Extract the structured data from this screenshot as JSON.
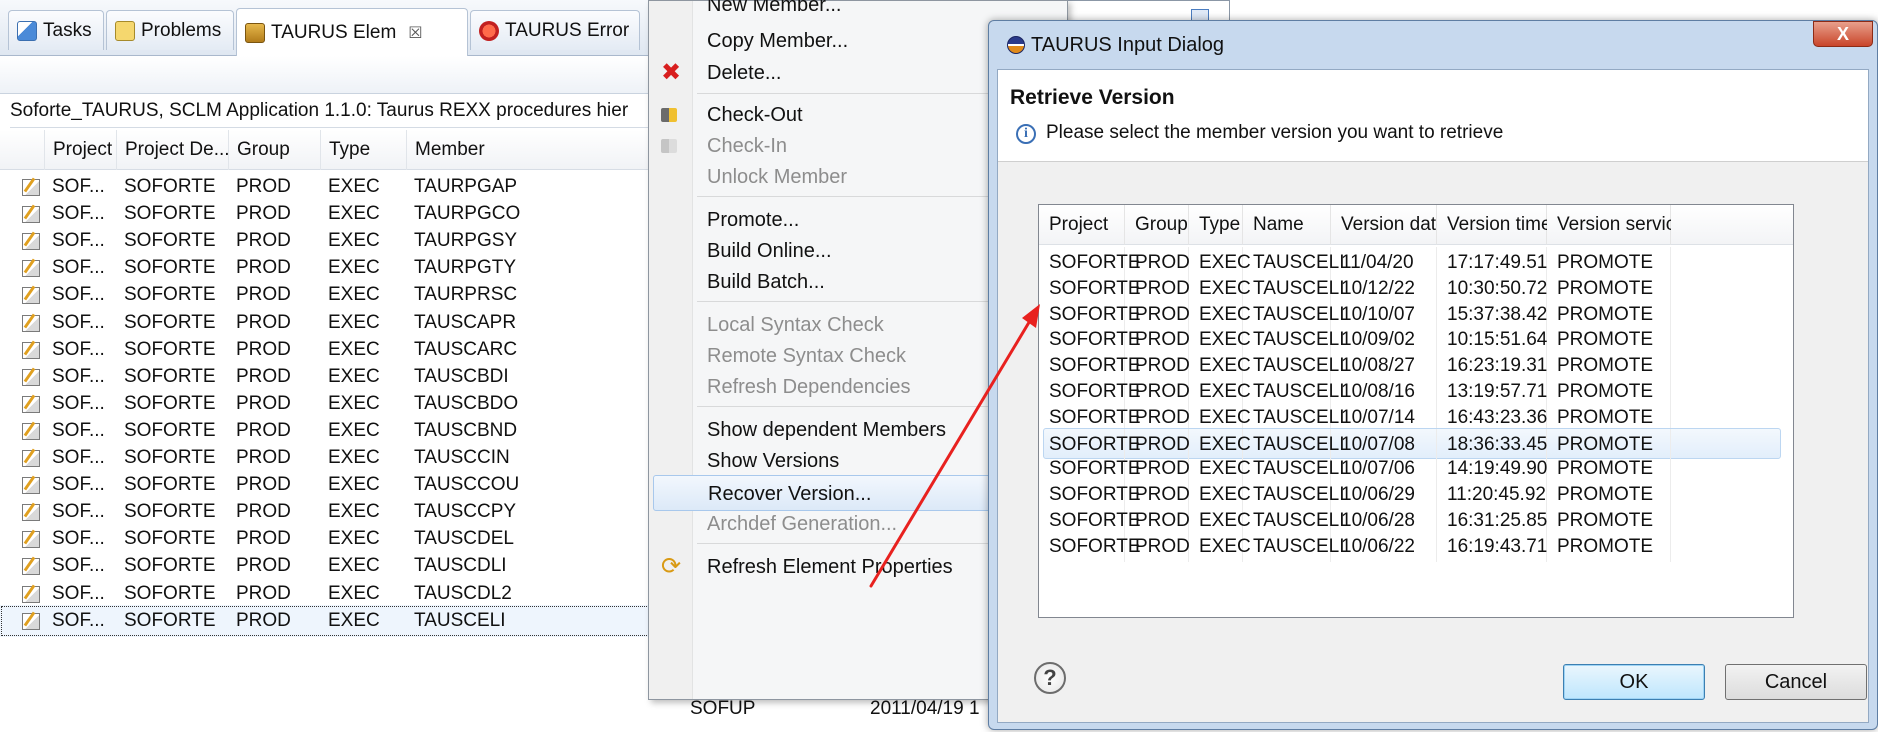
{
  "view": {
    "tabs": [
      {
        "label": "Tasks",
        "icon": "tasks-icon"
      },
      {
        "label": "Problems",
        "icon": "problems-icon"
      },
      {
        "label": "TAURUS Elem",
        "icon": "taurus-elements-icon",
        "close": "☒"
      },
      {
        "label": "TAURUS Error",
        "icon": "taurus-error-icon"
      }
    ],
    "description": "Soforte_TAURUS, SCLM Application 1.1.0: Taurus REXX procedures hier",
    "columns": [
      "Project",
      "Project De...",
      "Group",
      "Type",
      "Member"
    ],
    "rows": [
      [
        "SOF...",
        "SOFORTE",
        "PROD",
        "EXEC",
        "TAURPGAP"
      ],
      [
        "SOF...",
        "SOFORTE",
        "PROD",
        "EXEC",
        "TAURPGCO"
      ],
      [
        "SOF...",
        "SOFORTE",
        "PROD",
        "EXEC",
        "TAURPGSY"
      ],
      [
        "SOF...",
        "SOFORTE",
        "PROD",
        "EXEC",
        "TAURPGTY"
      ],
      [
        "SOF...",
        "SOFORTE",
        "PROD",
        "EXEC",
        "TAURPRSC"
      ],
      [
        "SOF...",
        "SOFORTE",
        "PROD",
        "EXEC",
        "TAUSCAPR"
      ],
      [
        "SOF...",
        "SOFORTE",
        "PROD",
        "EXEC",
        "TAUSCARC"
      ],
      [
        "SOF...",
        "SOFORTE",
        "PROD",
        "EXEC",
        "TAUSCBDI"
      ],
      [
        "SOF...",
        "SOFORTE",
        "PROD",
        "EXEC",
        "TAUSCBDO"
      ],
      [
        "SOF...",
        "SOFORTE",
        "PROD",
        "EXEC",
        "TAUSCBND"
      ],
      [
        "SOF...",
        "SOFORTE",
        "PROD",
        "EXEC",
        "TAUSCCIN"
      ],
      [
        "SOF...",
        "SOFORTE",
        "PROD",
        "EXEC",
        "TAUSCCOU"
      ],
      [
        "SOF...",
        "SOFORTE",
        "PROD",
        "EXEC",
        "TAUSCCPY"
      ],
      [
        "SOF...",
        "SOFORTE",
        "PROD",
        "EXEC",
        "TAUSCDEL"
      ],
      [
        "SOF...",
        "SOFORTE",
        "PROD",
        "EXEC",
        "TAUSCDLI"
      ],
      [
        "SOF...",
        "SOFORTE",
        "PROD",
        "EXEC",
        "TAUSCDL2"
      ],
      [
        "SOF...",
        "SOFORTE",
        "PROD",
        "EXEC",
        "TAUSCELI"
      ]
    ],
    "selected_row": 16,
    "hidden_row_extra": [
      "SOFUP",
      "2011/04/19 1"
    ]
  },
  "menu": {
    "items": [
      {
        "label": "New Member...",
        "enabled": true
      },
      {
        "label": "Copy Member...",
        "enabled": true
      },
      {
        "label": "Delete...",
        "enabled": true,
        "icon": "delete-icon"
      },
      {
        "label": "Check-Out",
        "enabled": true,
        "icon": "check-out-icon"
      },
      {
        "label": "Check-In",
        "enabled": false,
        "icon": "check-in-icon"
      },
      {
        "label": "Unlock Member",
        "enabled": false
      },
      {
        "label": "Promote...",
        "enabled": true
      },
      {
        "label": "Build Online...",
        "enabled": true
      },
      {
        "label": "Build Batch...",
        "enabled": true
      },
      {
        "label": "Local Syntax Check",
        "enabled": false
      },
      {
        "label": "Remote Syntax Check",
        "enabled": false
      },
      {
        "label": "Refresh Dependencies",
        "enabled": false
      },
      {
        "label": "Show dependent Members",
        "enabled": true
      },
      {
        "label": "Show Versions",
        "enabled": true
      },
      {
        "label": "Recover Version...",
        "enabled": true,
        "highlighted": true
      },
      {
        "label": "Archdef Generation...",
        "enabled": false
      },
      {
        "label": "Refresh Element Properties",
        "enabled": true,
        "icon": "refresh-icon"
      }
    ]
  },
  "dialog": {
    "title": "TAURUS Input Dialog",
    "close_label": "X",
    "heading": "Retrieve Version",
    "message": "Please select the member version you want to retrieve",
    "columns": [
      "Project",
      "Group",
      "Type",
      "Name",
      "Version date",
      "Version time",
      "Version service"
    ],
    "rows": [
      [
        "SOFORTE",
        "PROD",
        "EXEC",
        "TAUSCELI",
        "11/04/20",
        "17:17:49.51",
        "PROMOTE"
      ],
      [
        "SOFORTE",
        "PROD",
        "EXEC",
        "TAUSCELI",
        "10/12/22",
        "10:30:50.72",
        "PROMOTE"
      ],
      [
        "SOFORTE",
        "PROD",
        "EXEC",
        "TAUSCELI",
        "10/10/07",
        "15:37:38.42",
        "PROMOTE"
      ],
      [
        "SOFORTE",
        "PROD",
        "EXEC",
        "TAUSCELI",
        "10/09/02",
        "10:15:51.64",
        "PROMOTE"
      ],
      [
        "SOFORTE",
        "PROD",
        "EXEC",
        "TAUSCELI",
        "10/08/27",
        "16:23:19.31",
        "PROMOTE"
      ],
      [
        "SOFORTE",
        "PROD",
        "EXEC",
        "TAUSCELI",
        "10/08/16",
        "13:19:57.71",
        "PROMOTE"
      ],
      [
        "SOFORTE",
        "PROD",
        "EXEC",
        "TAUSCELI",
        "10/07/14",
        "16:43:23.36",
        "PROMOTE"
      ],
      [
        "SOFORTE",
        "PROD",
        "EXEC",
        "TAUSCELI",
        "10/07/08",
        "18:36:33.45",
        "PROMOTE"
      ],
      [
        "SOFORTE",
        "PROD",
        "EXEC",
        "TAUSCELI",
        "10/07/06",
        "14:19:49.90",
        "PROMOTE"
      ],
      [
        "SOFORTE",
        "PROD",
        "EXEC",
        "TAUSCELI",
        "10/06/29",
        "11:20:45.92",
        "PROMOTE"
      ],
      [
        "SOFORTE",
        "PROD",
        "EXEC",
        "TAUSCELI",
        "10/06/28",
        "16:31:25.85",
        "PROMOTE"
      ],
      [
        "SOFORTE",
        "PROD",
        "EXEC",
        "TAUSCELI",
        "10/06/22",
        "16:19:43.71",
        "PROMOTE"
      ]
    ],
    "selected_row": 7,
    "ok_label": "OK",
    "cancel_label": "Cancel",
    "help_label": "?",
    "info_label": "i"
  },
  "colors": {
    "accent": "#3c7fb1",
    "annotation_arrow": "#e8211f",
    "dialog_frame": "#c7d9ee",
    "delete_icon": "#d81e1e"
  }
}
